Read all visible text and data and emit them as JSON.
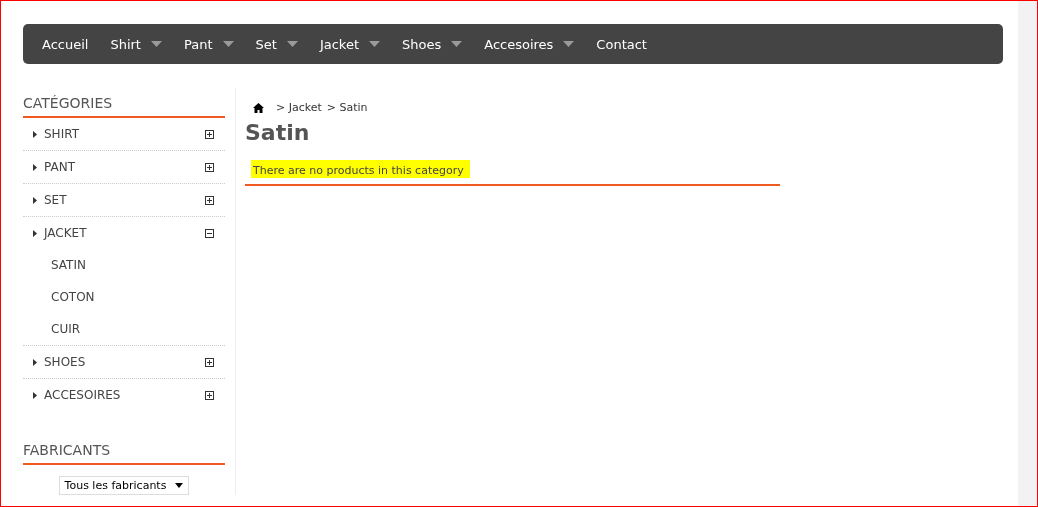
{
  "nav": [
    {
      "label": "Accueil",
      "dropdown": false
    },
    {
      "label": "Shirt",
      "dropdown": true
    },
    {
      "label": "Pant",
      "dropdown": true
    },
    {
      "label": "Set",
      "dropdown": true
    },
    {
      "label": "Jacket",
      "dropdown": true
    },
    {
      "label": "Shoes",
      "dropdown": true
    },
    {
      "label": "Accesoires",
      "dropdown": true
    },
    {
      "label": "Contact",
      "dropdown": false
    }
  ],
  "categories": {
    "title": "CATÉGORIES",
    "items": [
      {
        "label": "SHIRT",
        "expanded": false
      },
      {
        "label": "PANT",
        "expanded": false
      },
      {
        "label": "SET",
        "expanded": false
      },
      {
        "label": "JACKET",
        "expanded": true,
        "children": [
          {
            "label": "SATIN"
          },
          {
            "label": "COTON"
          },
          {
            "label": "CUIR"
          }
        ]
      },
      {
        "label": "SHOES",
        "expanded": false
      },
      {
        "label": "ACCESOIRES",
        "expanded": false
      }
    ]
  },
  "manufacturers": {
    "title": "FABRICANTS",
    "select": "Tous les fabricants"
  },
  "breadcrumb": [
    "> Jacket",
    "> Satin"
  ],
  "page_title": "Satin",
  "message": {
    "text": "There are no products in this category",
    "highlighted": true
  }
}
